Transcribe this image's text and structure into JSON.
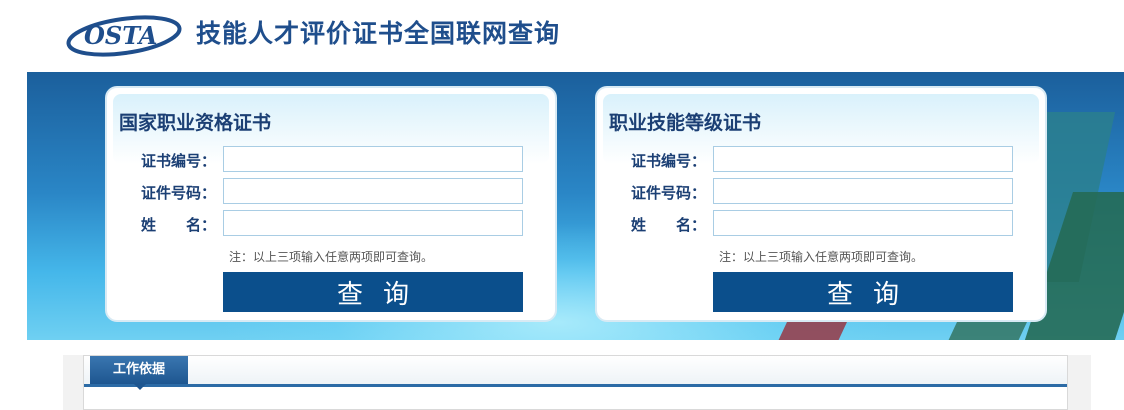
{
  "header": {
    "logo_text": "OSTA",
    "title": "技能人才评价证书全国联网查询"
  },
  "panels": [
    {
      "title": "国家职业资格证书",
      "fields": [
        {
          "label": "证书编号：",
          "value": ""
        },
        {
          "label": "证件号码：",
          "value": ""
        },
        {
          "label": "姓　　名：",
          "value": ""
        }
      ],
      "note": "注：以上三项输入任意两项即可查询。",
      "button": "查询"
    },
    {
      "title": "职业技能等级证书",
      "fields": [
        {
          "label": "证书编号：",
          "value": ""
        },
        {
          "label": "证件号码：",
          "value": ""
        },
        {
          "label": "姓　　名：",
          "value": ""
        }
      ],
      "note": "注：以上三项输入任意两项即可查询。",
      "button": "查询"
    }
  ],
  "tabs": [
    {
      "label": "工作依据"
    }
  ],
  "colors": {
    "brand_blue": "#1f4e8c",
    "button_blue": "#0b4f8c",
    "banner_top": "#1b5f9c",
    "banner_bottom": "#6fd0f2"
  }
}
